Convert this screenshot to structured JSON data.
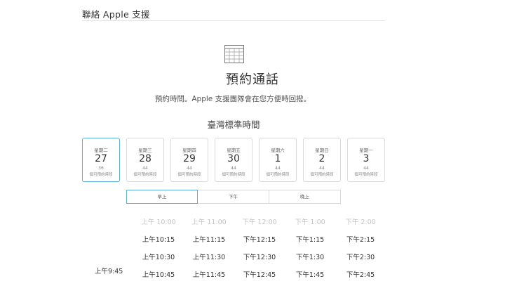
{
  "header": {
    "title": "聯絡 Apple 支援"
  },
  "icons": {
    "calendar": "calendar-icon"
  },
  "page": {
    "title": "預約通話",
    "subtitle": "預約時間。Apple 支援團隊會在您方便時回撥。",
    "timezone": "臺灣標準時間"
  },
  "colors": {
    "accent": "#5aaee0",
    "disabled_text": "#c4c4c4",
    "border": "#d9d9d9"
  },
  "days": [
    {
      "weekday": "星期二",
      "date": "27",
      "count": "36",
      "label": "個可預約時段",
      "selected": true
    },
    {
      "weekday": "星期三",
      "date": "28",
      "count": "44",
      "label": "個可預約時段",
      "selected": false
    },
    {
      "weekday": "星期四",
      "date": "29",
      "count": "44",
      "label": "個可預約時段",
      "selected": false
    },
    {
      "weekday": "星期五",
      "date": "30",
      "count": "44",
      "label": "個可預約時段",
      "selected": false
    },
    {
      "weekday": "星期六",
      "date": "1",
      "count": "44",
      "label": "個可預約時段",
      "selected": false
    },
    {
      "weekday": "星期日",
      "date": "2",
      "count": "44",
      "label": "個可預約時段",
      "selected": false
    },
    {
      "weekday": "星期一",
      "date": "3",
      "count": "44",
      "label": "個可預約時段",
      "selected": false
    }
  ],
  "periods": [
    {
      "label": "早上",
      "selected": true
    },
    {
      "label": "下午",
      "selected": false
    },
    {
      "label": "晚上",
      "selected": false
    }
  ],
  "time_slots": [
    [
      {
        "t": "上午 10:00",
        "disabled": true
      },
      {
        "t": "上午 11:00",
        "disabled": true
      },
      {
        "t": "下午 12:00",
        "disabled": true
      },
      {
        "t": "下午 1:00",
        "disabled": true
      },
      {
        "t": "下午 2:00",
        "disabled": true
      }
    ],
    [
      {
        "t": "上午10:15",
        "disabled": false
      },
      {
        "t": "上午11:15",
        "disabled": false
      },
      {
        "t": "下午12:15",
        "disabled": false
      },
      {
        "t": "下午1:15",
        "disabled": false
      },
      {
        "t": "下午2:15",
        "disabled": false
      }
    ],
    [
      {
        "t": "上午10:30",
        "disabled": false
      },
      {
        "t": "上午11:30",
        "disabled": false
      },
      {
        "t": "下午12:30",
        "disabled": false
      },
      {
        "t": "下午1:30",
        "disabled": false
      },
      {
        "t": "下午2:30",
        "disabled": false
      }
    ],
    [
      {
        "t": "上午10:45",
        "disabled": false
      },
      {
        "t": "上午11:45",
        "disabled": false
      },
      {
        "t": "下午12:45",
        "disabled": false
      },
      {
        "t": "下午1:45",
        "disabled": false
      },
      {
        "t": "下午2:45",
        "disabled": false
      }
    ]
  ],
  "left_slot": "上午9:45"
}
